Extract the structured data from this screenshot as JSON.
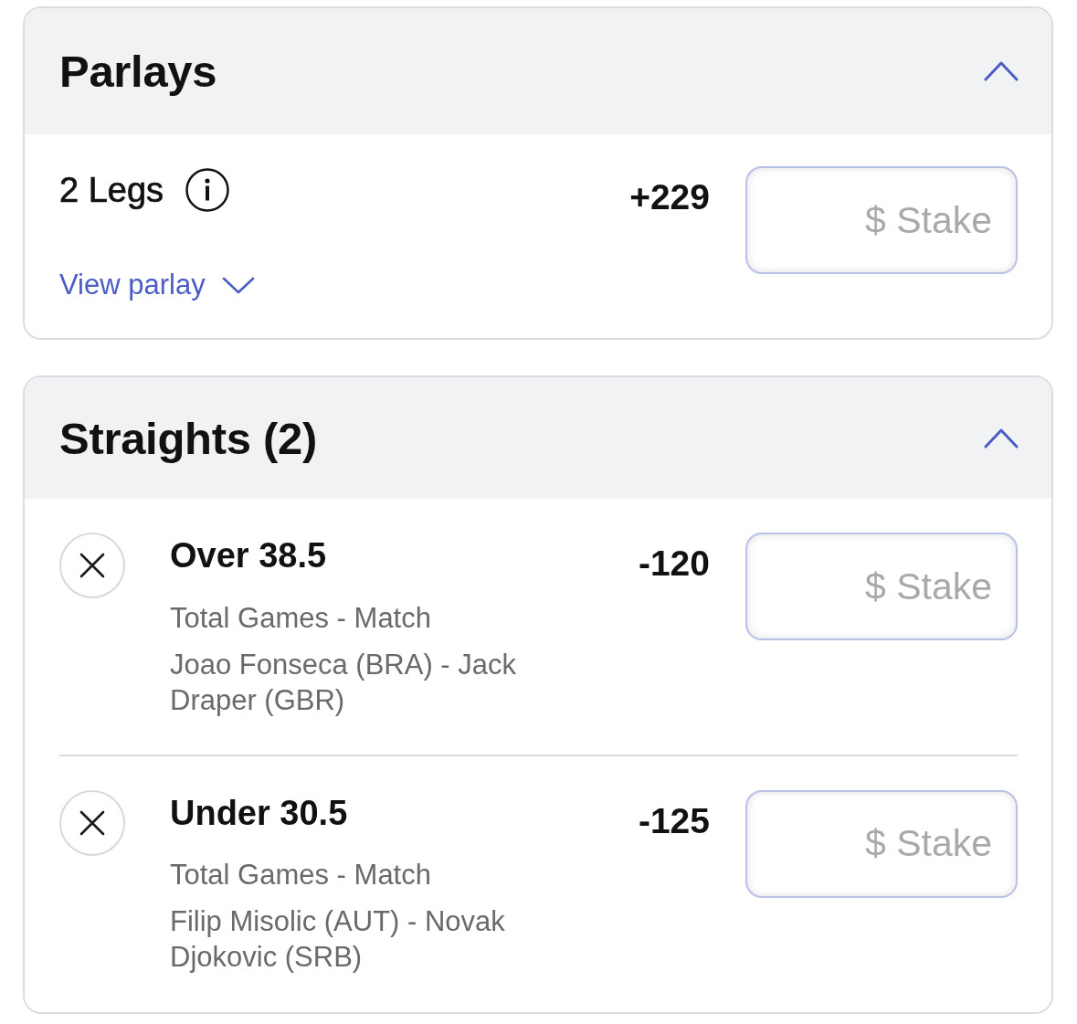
{
  "parlays": {
    "title": "Parlays",
    "expanded": true,
    "items": [
      {
        "legs": "2 Legs",
        "odds": "+229",
        "stake": {
          "placeholder": "$ Stake"
        },
        "view_link": {
          "label": "View parlay",
          "expanded": false
        }
      }
    ]
  },
  "straights": {
    "title": "Straights (2)",
    "expanded": true,
    "bets": [
      {
        "selection": "Over 38.5",
        "market": "Total Games - Match",
        "event": "Joao Fonseca (BRA) - Jack Draper (GBR)",
        "odds": "-120",
        "stake": {
          "placeholder": "$ Stake"
        }
      },
      {
        "selection": "Under 30.5",
        "market": "Total Games - Match",
        "event": "Filip Misolic (AUT) - Novak Djokovic (SRB)",
        "odds": "-125",
        "stake": {
          "placeholder": "$ Stake"
        }
      }
    ]
  }
}
